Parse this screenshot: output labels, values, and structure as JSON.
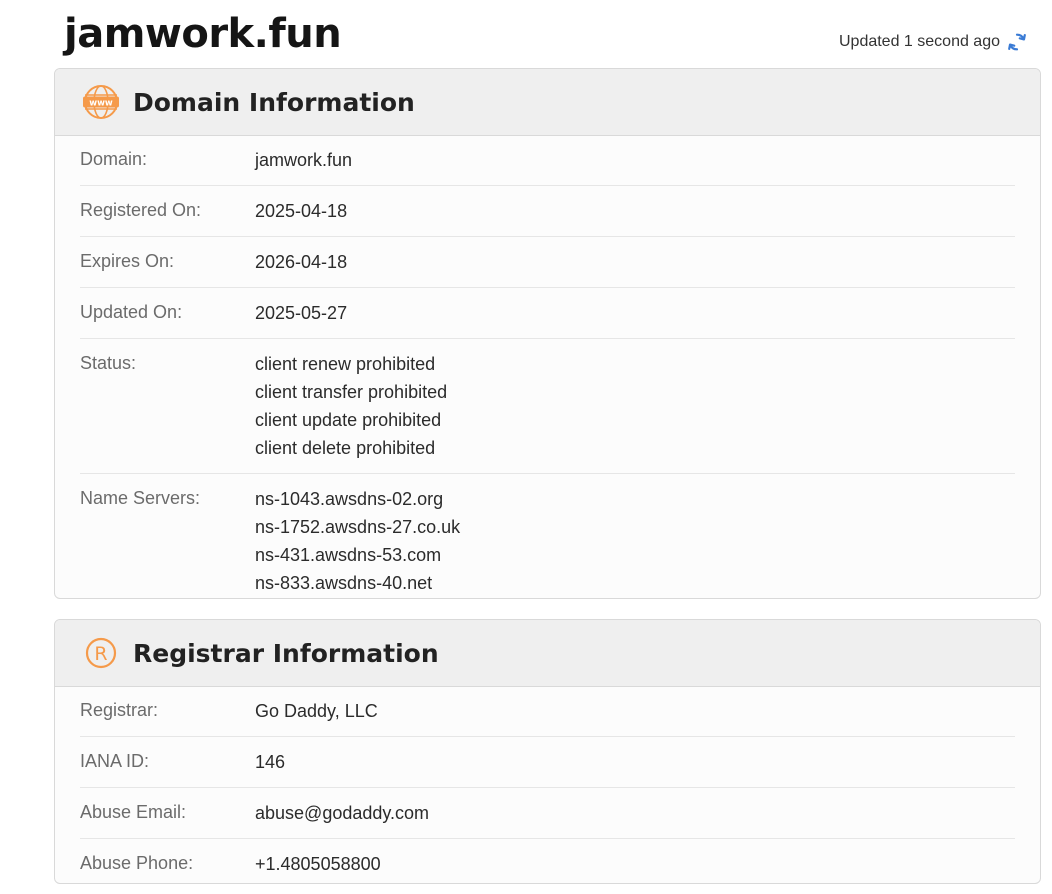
{
  "header": {
    "site_title": "jamwork.fun",
    "updated_text": "Updated 1 second ago",
    "refresh_icon": "refresh-icon",
    "accent_color": "#3a7bd5"
  },
  "domain_info": {
    "title": "Domain Information",
    "icon": "www-globe-icon",
    "icon_color": "#f59a4a",
    "rows": {
      "domain": {
        "label": "Domain:",
        "value": "jamwork.fun"
      },
      "registered": {
        "label": "Registered On:",
        "value": "2025-04-18"
      },
      "expires": {
        "label": "Expires On:",
        "value": "2026-04-18"
      },
      "updated": {
        "label": "Updated On:",
        "value": "2025-05-27"
      },
      "status": {
        "label": "Status:",
        "values": [
          "client renew prohibited",
          "client transfer prohibited",
          "client update prohibited",
          "client delete prohibited"
        ]
      },
      "name_servers": {
        "label": "Name Servers:",
        "values": [
          "ns-1043.awsdns-02.org",
          "ns-1752.awsdns-27.co.uk",
          "ns-431.awsdns-53.com",
          "ns-833.awsdns-40.net"
        ]
      }
    }
  },
  "registrar_info": {
    "title": "Registrar Information",
    "icon": "registered-trademark-icon",
    "icon_color": "#f59a4a",
    "rows": {
      "registrar": {
        "label": "Registrar:",
        "value": "Go Daddy, LLC"
      },
      "iana": {
        "label": "IANA ID:",
        "value": "146"
      },
      "abuse_email": {
        "label": "Abuse Email:",
        "value": "abuse@godaddy.com"
      },
      "abuse_phone": {
        "label": "Abuse Phone:",
        "value": "+1.4805058800"
      }
    }
  }
}
